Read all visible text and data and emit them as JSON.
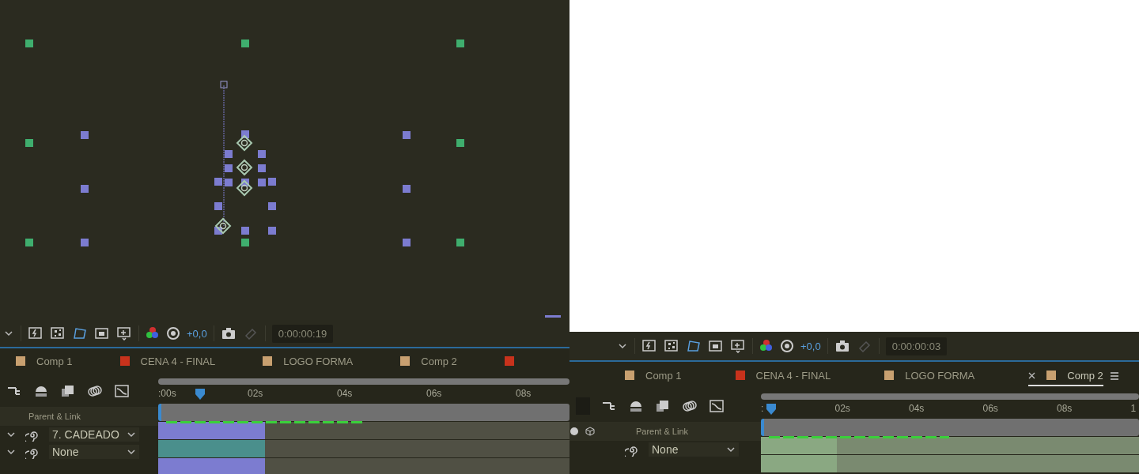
{
  "panels": [
    {
      "viewer": {
        "kind": "shapes"
      },
      "toolbar": {
        "exposure": "+0,0",
        "timecode": "0:00:00:19"
      },
      "tabs": [
        {
          "label": "Comp 1",
          "color": "#c8a070",
          "selected": false,
          "closable": false
        },
        {
          "label": "CENA 4 - FINAL",
          "color": "#c8321c",
          "selected": false,
          "closable": false
        },
        {
          "label": "LOGO FORMA",
          "color": "#c8a070",
          "selected": false,
          "closable": false
        },
        {
          "label": "Comp 2",
          "color": "#c8a070",
          "selected": false,
          "closable": false
        },
        {
          "color": "#c8321c",
          "selected": false,
          "closable": false
        }
      ],
      "ruler": {
        "ticks": [
          ":00s",
          "02s",
          "04s",
          "06s",
          "08s"
        ]
      },
      "column_header": "Parent & Link",
      "layers": [
        {
          "parent": "7. CADEADO",
          "color": "#7c7cd0",
          "bar": {
            "level": 0.26
          }
        },
        {
          "parent": "None",
          "color": "#4a8f8c",
          "bar": {
            "level": 0.26
          }
        }
      ]
    },
    {
      "viewer": {
        "kind": "empty"
      },
      "toolbar": {
        "exposure": "+0,0",
        "timecode": "0:00:00:03"
      },
      "tabs": [
        {
          "label": "Comp 1",
          "color": "#c8a070",
          "selected": false,
          "closable": false
        },
        {
          "label": "CENA 4 - FINAL",
          "color": "#c8321c",
          "selected": false,
          "closable": false
        },
        {
          "label": "LOGO FORMA",
          "color": "#c8a070",
          "selected": false,
          "closable": false
        },
        {
          "label": "Comp 2",
          "color": "#c8a070",
          "selected": true,
          "closable": true
        }
      ],
      "ruler": {
        "ticks": [
          ":",
          "02s",
          "04s",
          "06s",
          "08s",
          "1"
        ]
      },
      "column_header": "Parent & Link",
      "layers": [
        {
          "parent": "None",
          "color": "#8aa882",
          "bar": {
            "level": 0.2
          }
        }
      ]
    }
  ]
}
